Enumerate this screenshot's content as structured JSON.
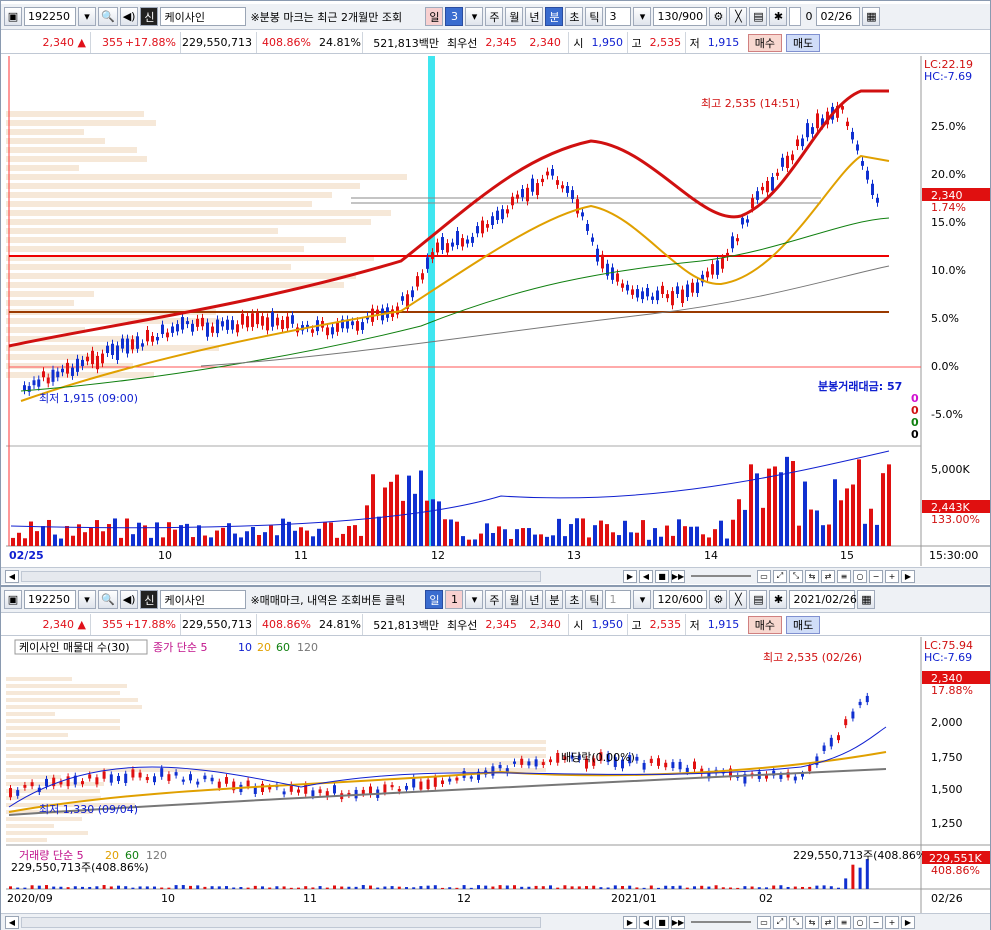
{
  "top": {
    "code": "192250",
    "name_badge": "신",
    "name": "케이사인",
    "notice": "※분봉 마크는 최근 2개월만 조회",
    "period_tabs": [
      "일",
      "3"
    ],
    "unit_tabs": [
      "주",
      "월",
      "년",
      "분",
      "초",
      "틱"
    ],
    "selected_unit": "분",
    "unit_value": "3",
    "count": "130/900",
    "check_label": "0",
    "date": "02/26",
    "info": {
      "price": "2,340 ▲",
      "change": "355",
      "pct": "+17.88%",
      "volume": "229,550,713",
      "vol_ratio": "408.86%",
      "turnover": "24.81%",
      "amount": "521,813백만",
      "best_label": "최우선",
      "ask": "2,345",
      "bid": "2,340",
      "open_label": "시",
      "open": "1,950",
      "high_label": "고",
      "high": "2,535",
      "low_label": "저",
      "low": "1,915",
      "buy": "매수",
      "sell": "매도"
    },
    "right_labels": {
      "lc": "LC:22.19",
      "hc": "HC:-7.69",
      "price_tag": "2,340",
      "price_pct": "1.74%",
      "vol_tag": "2,443K",
      "vol_pct": "133.00%"
    },
    "y_ticks": [
      "25.0%",
      "20.0%",
      "15.0%",
      "10.0%",
      "5.0%",
      "0.0%",
      "-5.0%"
    ],
    "vol_tick": "5,000K",
    "annotations": {
      "high": "최고 2,535 (14:51)",
      "low": "최저 1,915 (09:00)"
    },
    "legend": {
      "title": "분봉거래대금: 57",
      "v1": "0",
      "v2": "0",
      "v3": "0",
      "v4": "0"
    },
    "x_labels": [
      "02/25",
      "10",
      "11",
      "12",
      "13",
      "14",
      "15",
      "15:30:00"
    ]
  },
  "bottom": {
    "code": "192250",
    "name_badge": "신",
    "name": "케이사인",
    "notice": "※매매마크, 내역은 조회버튼 클릭",
    "period_tabs": [
      "일",
      "1"
    ],
    "unit_tabs": [
      "주",
      "월",
      "년",
      "분",
      "초",
      "틱"
    ],
    "selected_unit": "일",
    "unit_value": "1",
    "count": "120/600",
    "date": "2021/02/26",
    "info": {
      "price": "2,340 ▲",
      "change": "355",
      "pct": "+17.88%",
      "volume": "229,550,713",
      "vol_ratio": "408.86%",
      "turnover": "24.81%",
      "amount": "521,813백만",
      "best_label": "최우선",
      "ask": "2,345",
      "bid": "2,340",
      "open_label": "시",
      "open": "1,950",
      "high_label": "고",
      "high": "2,535",
      "low_label": "저",
      "low": "1,915",
      "buy": "매수",
      "sell": "매도"
    },
    "legend_box": "케이사인 매물대 수(30)",
    "ma_label": "종가 단순 5",
    "ma_values": [
      "10",
      "20",
      "60",
      "120"
    ],
    "right_labels": {
      "lc": "LC:75.94",
      "hc": "HC:-7.69",
      "price_tag": "2,340",
      "price_pct": "17.88%",
      "vol_tag": "229,551K",
      "vol_pct": "408.86%"
    },
    "y_ticks": [
      "2,000",
      "1,750",
      "1,500",
      "1,250"
    ],
    "annotations": {
      "high": "최고 2,535 (02/26)",
      "low": "최저 1,330 (09/04)",
      "div": "배당락(0.00%)"
    },
    "vol_legend": "거래량 단순 5",
    "vol_legend_values": [
      "20",
      "60",
      "120"
    ],
    "vol_sub": "229,550,713주(408.86%)",
    "vol_sub_right": "229,550,713주(408.86%)",
    "x_labels": [
      "2020/09",
      "10",
      "11",
      "12",
      "2021/01",
      "02",
      "02/26"
    ]
  }
}
